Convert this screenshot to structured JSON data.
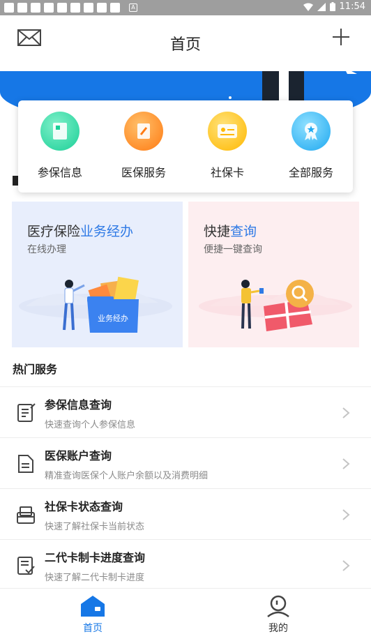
{
  "status_bar": {
    "time": "11:54",
    "app_glyph": "A"
  },
  "header": {
    "title": "首页",
    "left_icon": "mail-icon",
    "right_icon": "plus-icon"
  },
  "quick_menu": [
    {
      "label": "参保信息",
      "icon": "book-icon",
      "color": "#23d6a4"
    },
    {
      "label": "医保服务",
      "icon": "pencil-note-icon",
      "color": "#ff8a1e"
    },
    {
      "label": "社保卡",
      "icon": "id-card-icon",
      "color": "#ffc21a"
    },
    {
      "label": "全部服务",
      "icon": "medal-icon",
      "color": "#2cb6f5"
    }
  ],
  "promos": [
    {
      "title_main": "医疗保险",
      "title_highlight": "业务经办",
      "subtitle": "在线办理",
      "badge": "业务经办"
    },
    {
      "title_main": "快捷",
      "title_highlight": "查询",
      "subtitle": "便捷一键查询"
    }
  ],
  "hot_services": {
    "title": "热门服务",
    "items": [
      {
        "title": "参保信息查询",
        "subtitle": "快速查询个人参保信息",
        "icon": "checklist-icon"
      },
      {
        "title": "医保账户查询",
        "subtitle": "精准查询医保个人账户余额以及消费明细",
        "icon": "document-icon"
      },
      {
        "title": "社保卡状态查询",
        "subtitle": "快速了解社保卡当前状态",
        "icon": "card-reader-icon"
      },
      {
        "title": "二代卡制卡进度查询",
        "subtitle": "快速了解二代卡制卡进度",
        "icon": "document-check-icon"
      }
    ]
  },
  "tabs": [
    {
      "label": "首页",
      "icon": "home-icon",
      "active": true
    },
    {
      "label": "我的",
      "icon": "user-icon",
      "active": false
    }
  ],
  "colors": {
    "accent": "#1677e6",
    "active_tab": "#1677e6",
    "inactive_tab": "#333333"
  }
}
